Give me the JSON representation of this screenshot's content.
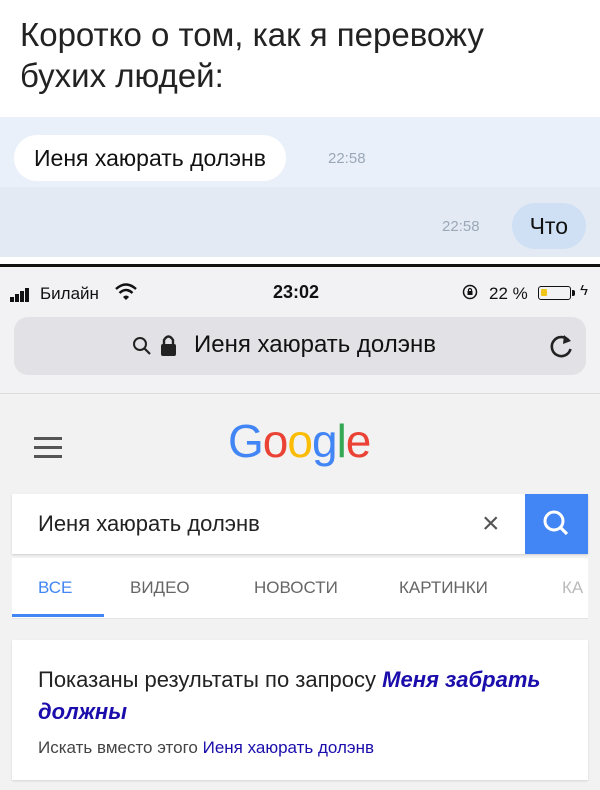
{
  "caption": {
    "line1": "Коротко о том, как я перевожу",
    "line2": "бухих людей:"
  },
  "chat": {
    "incoming": {
      "text": "Иеня хаюрать долэнв",
      "time": "22:58"
    },
    "outgoing": {
      "text": "Что",
      "time": "22:58"
    }
  },
  "status_bar": {
    "carrier": "Билайн",
    "time": "23:02",
    "battery_percent": "22 %",
    "battery_level": 0.22,
    "battery_color": "#f0c419"
  },
  "url_bar": {
    "text": "Иеня хаюрать долэнв",
    "icons": [
      "search-icon",
      "lock-icon",
      "reload-icon"
    ]
  },
  "google": {
    "logo_letters": [
      {
        "ch": "G",
        "color": "#4285f4"
      },
      {
        "ch": "o",
        "color": "#ea4335"
      },
      {
        "ch": "o",
        "color": "#fbbc05"
      },
      {
        "ch": "g",
        "color": "#4285f4"
      },
      {
        "ch": "l",
        "color": "#34a853"
      },
      {
        "ch": "e",
        "color": "#ea4335"
      }
    ],
    "search_value": "Иеня хаюрать долэнв",
    "clear_symbol": "×",
    "tabs": [
      "ВСЕ",
      "ВИДЕО",
      "НОВОСТИ",
      "КАРТИНКИ",
      "КА"
    ],
    "active_tab": "ВСЕ",
    "accent": "#4285f4"
  },
  "result": {
    "showing_prefix": "Показаны результаты по запросу ",
    "corrected_query": "Меня забрать должны",
    "instead_prefix": "Искать вместо этого ",
    "original_query": "Иеня хаюрать долэнв"
  }
}
